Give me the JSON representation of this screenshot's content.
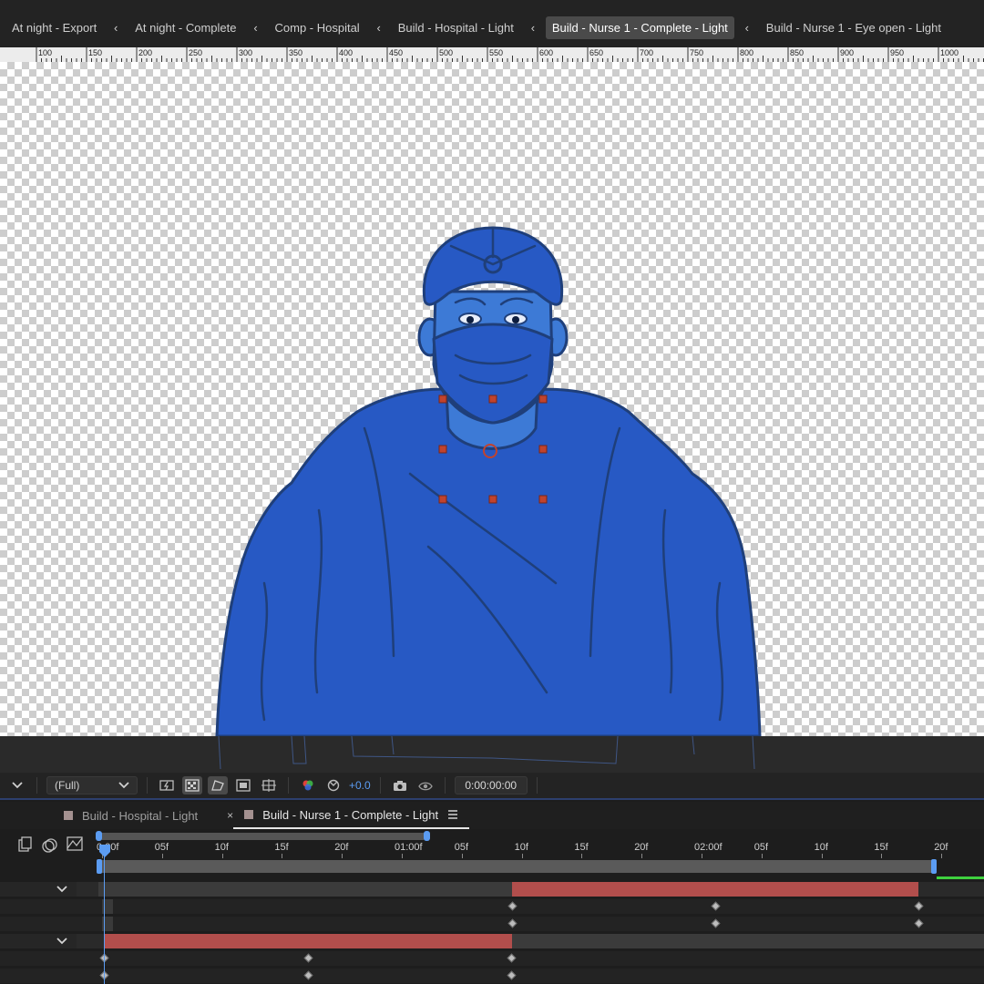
{
  "breadcrumbs": [
    {
      "label": "At night - Export",
      "active": false
    },
    {
      "label": "At night - Complete",
      "active": false
    },
    {
      "label": "Comp - Hospital",
      "active": false
    },
    {
      "label": "Build - Hospital - Light",
      "active": false
    },
    {
      "label": "Build - Nurse 1 - Complete - Light",
      "active": true
    },
    {
      "label": "Build - Nurse 1 - Eye open - Light",
      "active": false
    }
  ],
  "ruler": {
    "labels": [
      "100",
      "150",
      "200",
      "250",
      "300",
      "350",
      "400",
      "450",
      "500",
      "550",
      "600",
      "650",
      "700",
      "750",
      "800",
      "850",
      "900",
      "950",
      "1000"
    ]
  },
  "viewer_toolbar": {
    "resolution": "(Full)",
    "exposure": "+0.0",
    "timecode": "0:00:00:00"
  },
  "timeline_tabs": [
    {
      "label": "Build - Hospital - Light",
      "active": false,
      "close": ""
    },
    {
      "label": "Build - Nurse 1 - Complete - Light",
      "active": true,
      "close": "×"
    }
  ],
  "timeline": {
    "ruler_labels": [
      "0:00f",
      "05f",
      "10f",
      "15f",
      "20f",
      "01:00f",
      "05f",
      "10f",
      "15f",
      "20f",
      "02:00f",
      "05f",
      "10f",
      "15f",
      "20f"
    ],
    "colors": {
      "layer_bar": "#b24e4c",
      "work_area": "#5a5a5a",
      "playhead": "#5b9cf2",
      "green_line": "#3fd13f"
    }
  }
}
